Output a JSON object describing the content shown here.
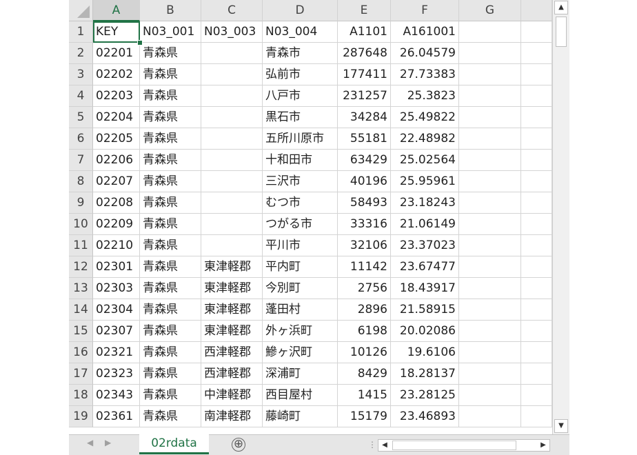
{
  "sheet": {
    "columns": [
      "A",
      "B",
      "C",
      "D",
      "E",
      "F",
      "G",
      ""
    ],
    "rows": [
      {
        "n": "1",
        "cells": [
          "KEY",
          "N03_001",
          "N03_003",
          "N03_004",
          "A1101",
          "A161001"
        ]
      },
      {
        "n": "2",
        "cells": [
          "02201",
          "青森県",
          "",
          "青森市",
          "287648",
          "26.04579"
        ]
      },
      {
        "n": "3",
        "cells": [
          "02202",
          "青森県",
          "",
          "弘前市",
          "177411",
          "27.73383"
        ]
      },
      {
        "n": "4",
        "cells": [
          "02203",
          "青森県",
          "",
          "八戸市",
          "231257",
          "25.3823"
        ]
      },
      {
        "n": "5",
        "cells": [
          "02204",
          "青森県",
          "",
          "黒石市",
          "34284",
          "25.49822"
        ]
      },
      {
        "n": "6",
        "cells": [
          "02205",
          "青森県",
          "",
          "五所川原市",
          "55181",
          "22.48982"
        ]
      },
      {
        "n": "7",
        "cells": [
          "02206",
          "青森県",
          "",
          "十和田市",
          "63429",
          "25.02564"
        ]
      },
      {
        "n": "8",
        "cells": [
          "02207",
          "青森県",
          "",
          "三沢市",
          "40196",
          "25.95961"
        ]
      },
      {
        "n": "9",
        "cells": [
          "02208",
          "青森県",
          "",
          "むつ市",
          "58493",
          "23.18243"
        ]
      },
      {
        "n": "10",
        "cells": [
          "02209",
          "青森県",
          "",
          "つがる市",
          "33316",
          "21.06149"
        ]
      },
      {
        "n": "11",
        "cells": [
          "02210",
          "青森県",
          "",
          "平川市",
          "32106",
          "23.37023"
        ]
      },
      {
        "n": "12",
        "cells": [
          "02301",
          "青森県",
          "東津軽郡",
          "平内町",
          "11142",
          "23.67477"
        ]
      },
      {
        "n": "13",
        "cells": [
          "02303",
          "青森県",
          "東津軽郡",
          "今別町",
          "2756",
          "18.43917"
        ]
      },
      {
        "n": "14",
        "cells": [
          "02304",
          "青森県",
          "東津軽郡",
          "蓬田村",
          "2896",
          "21.58915"
        ]
      },
      {
        "n": "15",
        "cells": [
          "02307",
          "青森県",
          "東津軽郡",
          "外ヶ浜町",
          "6198",
          "20.02086"
        ]
      },
      {
        "n": "16",
        "cells": [
          "02321",
          "青森県",
          "西津軽郡",
          "鰺ヶ沢町",
          "10126",
          "19.6106"
        ]
      },
      {
        "n": "17",
        "cells": [
          "02323",
          "青森県",
          "西津軽郡",
          "深浦町",
          "8429",
          "18.28137"
        ]
      },
      {
        "n": "18",
        "cells": [
          "02343",
          "青森県",
          "中津軽郡",
          "西目屋村",
          "1415",
          "23.28125"
        ]
      },
      {
        "n": "19",
        "cells": [
          "02361",
          "青森県",
          "南津軽郡",
          "藤崎町",
          "15179",
          "23.46893"
        ]
      }
    ]
  },
  "tabs": {
    "active": "02rdata",
    "add_symbol": "⊕"
  },
  "icons": {
    "corner": "select-all-icon",
    "scroll_up": "▲",
    "scroll_down": "▼",
    "left": "◀",
    "right": "▶",
    "nav_prev": "◀",
    "nav_next": "▶",
    "dots": "⋮"
  },
  "colors": {
    "accent": "#217346"
  }
}
